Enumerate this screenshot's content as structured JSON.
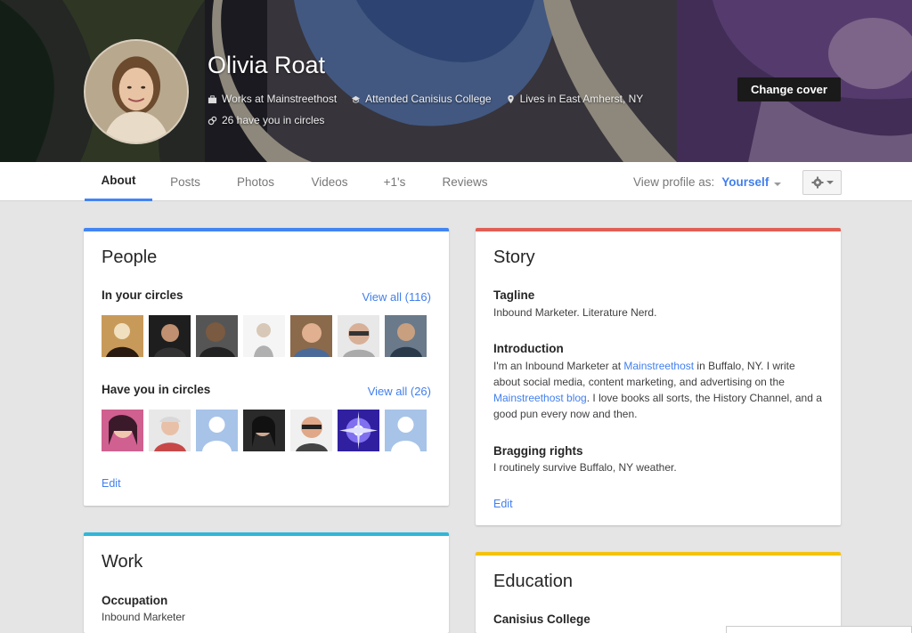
{
  "profile": {
    "name": "Olivia Roat",
    "works_at": "Works at Mainstreethost",
    "attended": "Attended Canisius College",
    "lives_in": "Lives in East Amherst, NY",
    "circles": "26 have you in circles",
    "change_cover_label": "Change cover"
  },
  "tabs": [
    {
      "label": "About"
    },
    {
      "label": "Posts"
    },
    {
      "label": "Photos"
    },
    {
      "label": "Videos"
    },
    {
      "label": "+1's"
    },
    {
      "label": "Reviews"
    }
  ],
  "view_as": {
    "label": "View profile as:",
    "value": "Yourself"
  },
  "people": {
    "title": "People",
    "in_circles_label": "In your circles",
    "in_circles_view_all": "View all (116)",
    "have_you_label": "Have you in circles",
    "have_you_view_all": "View all (26)",
    "edit_label": "Edit"
  },
  "story": {
    "title": "Story",
    "tagline_label": "Tagline",
    "tagline_value": "Inbound Marketer. Literature Nerd.",
    "intro_label": "Introduction",
    "intro_part1": "I'm an Inbound Marketer at ",
    "intro_link1": "Mainstreethost",
    "intro_part2": " in Buffalo, NY. I write about social media, content marketing, and advertising on the ",
    "intro_link2": "Mainstreethost blog",
    "intro_part3": ". I love books all sorts, the History Channel, and a good pun every now and then.",
    "bragging_label": "Bragging rights",
    "bragging_value": "I routinely survive Buffalo, NY weather.",
    "edit_label": "Edit"
  },
  "work": {
    "title": "Work",
    "occupation_label": "Occupation",
    "occupation_value": "Inbound Marketer"
  },
  "education": {
    "title": "Education",
    "school": "Canisius College"
  },
  "colors": {
    "people_accent": "#4285f4",
    "story_accent": "#e06055",
    "work_accent": "#2eb7d9",
    "education_accent": "#f4c20d",
    "link": "#427fed"
  }
}
